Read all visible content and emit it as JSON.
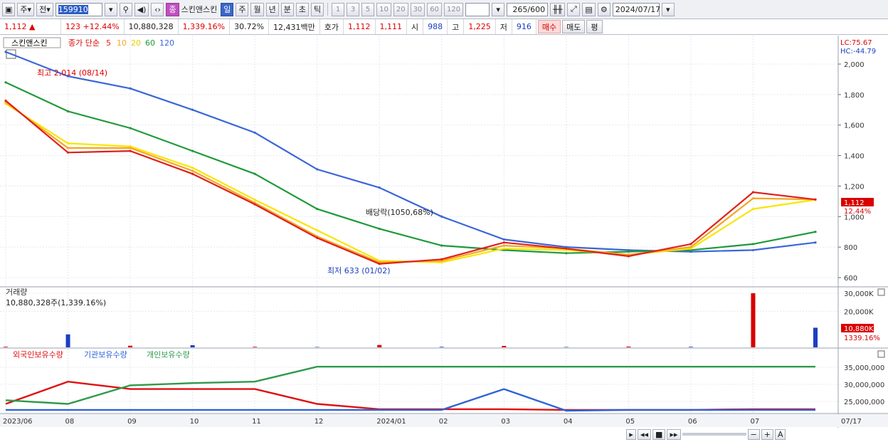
{
  "toolbar": {
    "market": "주",
    "prev": "전",
    "code": "159910",
    "badge": "종",
    "name": "스킨앤스킨",
    "periods": [
      "일",
      "주",
      "월",
      "년",
      "분",
      "초",
      "틱"
    ],
    "active_period": "일",
    "minutes": [
      "1",
      "3",
      "5",
      "10",
      "20",
      "30",
      "60",
      "120"
    ],
    "count": "265",
    "count_max": "/600",
    "date": "2024/07/17"
  },
  "quote": {
    "price": "1,112",
    "arrow": "▲",
    "change": "123",
    "change_pct": "+12.44%",
    "volume": "10,880,328",
    "volume_pct": "1,339.16%",
    "turnover": "30.72%",
    "amount": "12,431백만",
    "hoga_label": "호가",
    "ask": "1,112",
    "bid": "1,111",
    "open_label": "시",
    "open": "988",
    "high_label": "고",
    "high": "1,225",
    "low_label": "저",
    "low": "916",
    "buy": "매수",
    "sell": "매도",
    "eval": "평"
  },
  "colors": {
    "up": "#d80000",
    "down": "#1c3fc2",
    "ma5": "#e0201a",
    "ma10": "#f5a623",
    "ma20": "#f7e600",
    "ma60": "#1f9a3a",
    "ma120": "#3a66d6",
    "foreign": "#e01010",
    "inst": "#2e62d8",
    "retail": "#2e9a4a"
  },
  "legend": {
    "name": "스킨앤스킨",
    "title": "종가 단순",
    "ma": [
      "5",
      "10",
      "20",
      "60",
      "120"
    ]
  },
  "scale_labels": {
    "lc": "LC:75.67",
    "hc": "HC:-44.79"
  },
  "annotations": {
    "high": "최고 2,014 (08/14)",
    "low": "최저 633 (01/02)",
    "ex_rights": "배당락(1050,68%)"
  },
  "price_badge": {
    "value": "1,112",
    "pct": "12.44%"
  },
  "volume_panel": {
    "title": "거래량",
    "subtitle": "10,880,328주(1,339.16%)",
    "badge_value": "10,880K",
    "badge_pct": "1339.16%"
  },
  "holdings_panel": {
    "titles": [
      "외국인보유수량",
      "기관보유수량",
      "개인보유수량"
    ]
  },
  "chart_data": [
    {
      "type": "line",
      "x": [
        "2023/06",
        "08",
        "09",
        "10",
        "11",
        "12",
        "2024/01",
        "02",
        "03",
        "04",
        "05",
        "06",
        "07",
        "07/17"
      ],
      "series": [
        {
          "name": "5",
          "values": [
            1760,
            1420,
            1430,
            1280,
            1080,
            860,
            690,
            720,
            830,
            790,
            740,
            820,
            1160,
            1112
          ]
        },
        {
          "name": "10",
          "values": [
            1750,
            1450,
            1450,
            1300,
            1090,
            870,
            700,
            710,
            810,
            790,
            750,
            800,
            1120,
            1112
          ]
        },
        {
          "name": "20",
          "values": [
            1740,
            1480,
            1460,
            1320,
            1110,
            910,
            710,
            700,
            790,
            780,
            750,
            790,
            1050,
            1110
          ]
        },
        {
          "name": "60",
          "values": [
            1880,
            1690,
            1580,
            1430,
            1280,
            1050,
            920,
            810,
            780,
            760,
            770,
            780,
            820,
            900
          ]
        },
        {
          "name": "120",
          "values": [
            2080,
            1920,
            1840,
            1700,
            1550,
            1310,
            1190,
            1000,
            850,
            800,
            780,
            770,
            780,
            830
          ]
        }
      ],
      "ylim": [
        600,
        2000
      ],
      "yticks": [
        600,
        800,
        "1,000",
        "1,200",
        "1,400",
        "1,600",
        "1,800",
        "2,000"
      ]
    },
    {
      "type": "bar",
      "title": "거래량",
      "x": [
        "2023/06",
        "08",
        "09",
        "10",
        "11",
        "12",
        "2024/01",
        "02",
        "03",
        "04",
        "05",
        "06",
        "07",
        "07/17"
      ],
      "values": [
        300,
        7200,
        900,
        1200,
        300,
        200,
        1300,
        300,
        800,
        200,
        400,
        300,
        30000,
        10880
      ],
      "unit": "K",
      "ylim": [
        0,
        30000
      ],
      "yticks": [
        "20,000K",
        "30,000K"
      ]
    },
    {
      "type": "line",
      "x": [
        "2023/06",
        "08",
        "09",
        "10",
        "11",
        "12",
        "2024/01",
        "02",
        "03",
        "04",
        "05",
        "06",
        "07",
        "07/17"
      ],
      "series": [
        {
          "name": "외국인보유수량",
          "values": [
            1,
            4,
            3,
            3,
            3,
            1,
            0.3,
            0.3,
            0.3,
            0.2,
            0.2,
            0.2,
            0.3,
            0.3
          ]
        },
        {
          "name": "기관보유수량",
          "values": [
            0.2,
            0.2,
            0.2,
            0.2,
            0.2,
            0.2,
            0.2,
            0.2,
            3,
            0.1,
            0.2,
            0.2,
            0.2,
            0.2
          ]
        },
        {
          "name": "개인보유수량",
          "values": [
            1.5,
            1,
            3.5,
            3.8,
            4,
            6,
            6,
            6,
            6,
            6,
            6,
            6,
            6,
            6
          ]
        }
      ],
      "yticks": [
        "25,000,000",
        "30,000,000",
        "35,000,000"
      ]
    }
  ]
}
